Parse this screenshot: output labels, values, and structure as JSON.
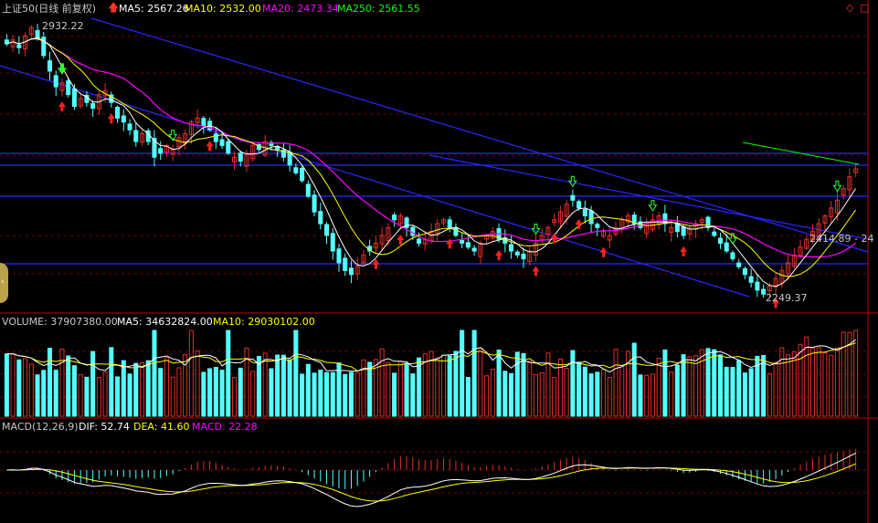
{
  "header": {
    "title": "上证50(日线 前复权)",
    "ma5_label": "MA5: 2567.26",
    "ma10_label": "MA10: 2532.00",
    "ma20_label": "MA20: 2473.34",
    "ma250_label": "MA250: 2561.55"
  },
  "volume_header": {
    "volume_label": "VOLUME: 37907380.00",
    "ma5_label": "MA5: 34632824.00",
    "ma10_label": "MA10: 29030102.00"
  },
  "macd_header": {
    "macd_label": "MACD(12,26,9)",
    "dif_label": "DIF: 52.74",
    "dea_label": "DEA: 41.60",
    "macd_value_label": "MACD: 22.28"
  },
  "annotations": {
    "high_label": "2932.22",
    "low_label": "2249.37",
    "right_label": "2414.89 - 24"
  },
  "colors": {
    "up": "#e0302a",
    "down": "#54ffff",
    "ma5": "#ffffff",
    "ma10": "#ffff00",
    "ma20": "#ff00ff",
    "ma250": "#00ff00",
    "trendline": "#2828ff",
    "grid": "#7a0000",
    "title": "#c8c8c8",
    "dif": "#ffffff",
    "dea": "#ffff00",
    "macd": "#ff00ff"
  },
  "chart_data": [
    {
      "type": "candlestick",
      "series": [
        {
          "name": "MA5",
          "values": [
            2567.26
          ]
        },
        {
          "name": "MA10",
          "values": [
            2532.0
          ]
        },
        {
          "name": "MA20",
          "values": [
            2473.34
          ]
        },
        {
          "name": "MA250",
          "values": [
            2561.55
          ]
        }
      ],
      "annotations": [
        {
          "text": "2932.22"
        },
        {
          "text": "2249.37"
        },
        {
          "text": "2414.89 - 24"
        }
      ],
      "close": [
        2890,
        2900,
        2880,
        2910,
        2932,
        2905,
        2860,
        2820,
        2780,
        2790,
        2760,
        2730,
        2750,
        2740,
        2725,
        2760,
        2770,
        2740,
        2700,
        2690,
        2670,
        2640,
        2660,
        2640,
        2600,
        2610,
        2630,
        2620,
        2650,
        2660,
        2690,
        2700,
        2680,
        2670,
        2640,
        2630,
        2610,
        2600,
        2590,
        2610,
        2630,
        2620,
        2640,
        2630,
        2620,
        2600,
        2580,
        2560,
        2540,
        2500,
        2460,
        2430,
        2400,
        2360,
        2330,
        2310,
        2300,
        2320,
        2350,
        2360,
        2380,
        2400,
        2420,
        2440,
        2450,
        2420,
        2400,
        2380,
        2390,
        2410,
        2430,
        2440,
        2420,
        2400,
        2380,
        2370,
        2360,
        2380,
        2400,
        2410,
        2390,
        2380,
        2360,
        2350,
        2340,
        2360,
        2380,
        2400,
        2420,
        2440,
        2460,
        2480,
        2490,
        2470,
        2450,
        2430,
        2420,
        2410,
        2400,
        2420,
        2440,
        2450,
        2430,
        2420,
        2430,
        2440,
        2450,
        2430,
        2420,
        2410,
        2400,
        2420,
        2430,
        2440,
        2420,
        2400,
        2380,
        2360,
        2340,
        2320,
        2300,
        2280,
        2260,
        2250,
        2270,
        2290,
        2310,
        2330,
        2350,
        2370,
        2390,
        2410,
        2430,
        2450,
        2470,
        2490,
        2520,
        2550,
        2570
      ],
      "grid": true,
      "legend": "top-left"
    },
    {
      "type": "bar",
      "series": [
        {
          "name": "VOLUME",
          "values": [
            37907380.0
          ]
        },
        {
          "name": "MA5",
          "values": [
            34632824.0
          ]
        },
        {
          "name": "MA10",
          "values": [
            29030102.0
          ]
        }
      ]
    },
    {
      "type": "bar",
      "series": [
        {
          "name": "DIF",
          "values": [
            52.74
          ]
        },
        {
          "name": "DEA",
          "values": [
            41.6
          ]
        },
        {
          "name": "MACD",
          "values": [
            22.28
          ]
        }
      ]
    }
  ]
}
